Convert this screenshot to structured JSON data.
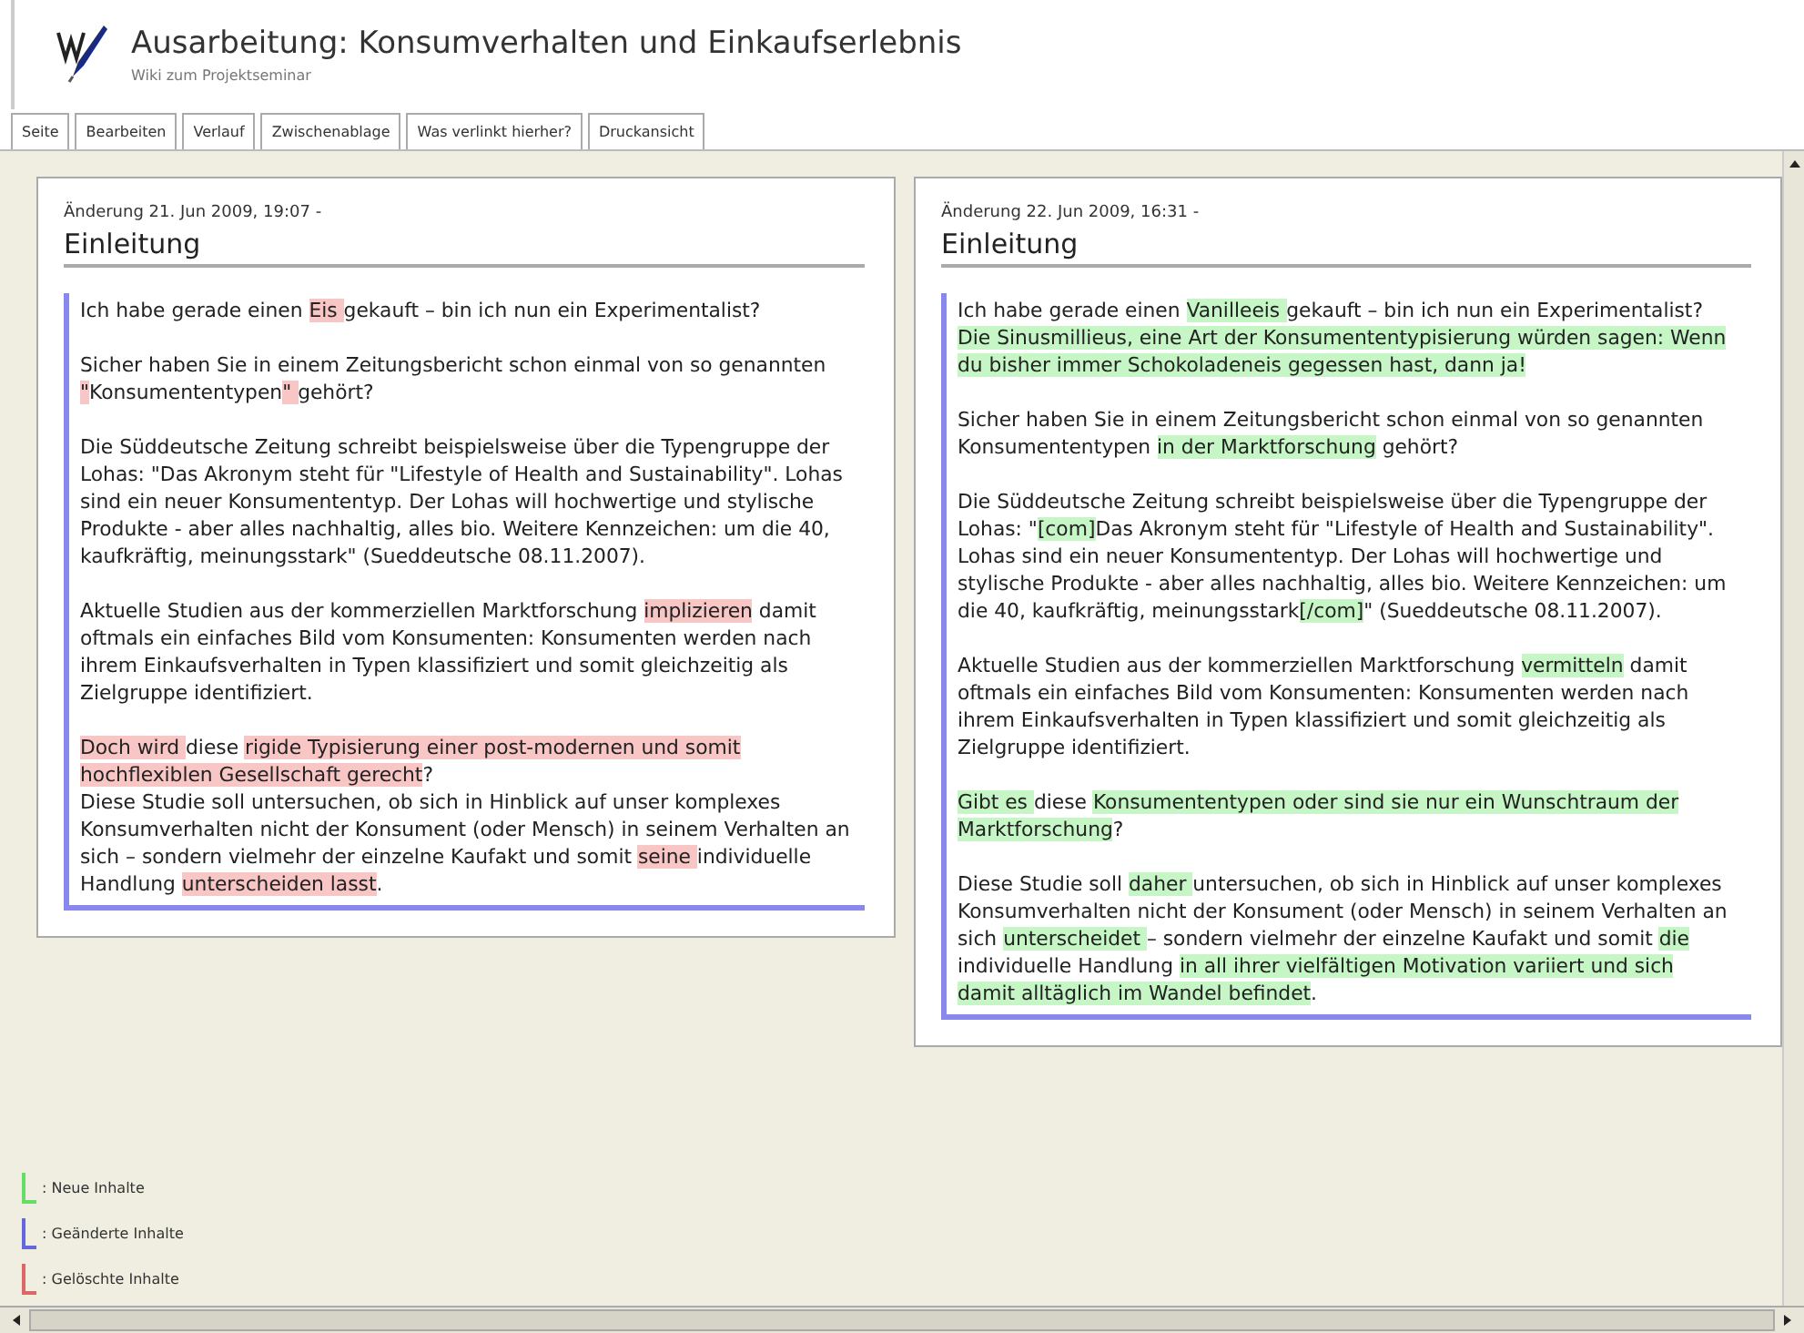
{
  "header": {
    "title": "Ausarbeitung: Konsumverhalten und Einkaufserlebnis",
    "subtitle": "Wiki zum Projektseminar"
  },
  "tabs": [
    {
      "label": "Seite"
    },
    {
      "label": "Bearbeiten"
    },
    {
      "label": "Verlauf"
    },
    {
      "label": "Zwischenablage"
    },
    {
      "label": "Was verlinkt hierher?"
    },
    {
      "label": "Druckansicht"
    }
  ],
  "revisions": [
    {
      "kind": "old",
      "meta": "Änderung 21. Jun 2009, 19:07 -",
      "heading": "Einleitung",
      "paragraphs": [
        [
          {
            "text": "Ich habe gerade einen ",
            "marked": false
          },
          {
            "text": "Eis ",
            "marked": true
          },
          {
            "text": "gekauft – bin ich nun ein Experimentalist?",
            "marked": false
          }
        ],
        [
          {
            "text": "Sicher haben Sie in einem Zeitungsbericht schon einmal von so genannten ",
            "marked": false
          },
          {
            "text": "\"",
            "marked": true
          },
          {
            "text": "Konsumententypen",
            "marked": false
          },
          {
            "text": "\" ",
            "marked": true
          },
          {
            "text": "gehört?",
            "marked": false
          }
        ],
        [
          {
            "text": "Die Süddeutsche Zeitung schreibt beispielsweise über die Typengruppe der Lohas: \"Das Akronym steht für \"Lifestyle of Health and Sustainability\". Lohas sind ein neuer Konsumententyp. Der Lohas will hochwertige und stylische Produkte - aber alles nachhaltig, alles bio. Weitere Kennzeichen: um die 40, kaufkräftig, meinungsstark\" (Sueddeutsche 08.11.2007).",
            "marked": false
          }
        ],
        [
          {
            "text": "Aktuelle Studien aus der kommerziellen Marktforschung ",
            "marked": false
          },
          {
            "text": "implizieren",
            "marked": true
          },
          {
            "text": " damit oftmals ein einfaches Bild vom Konsumenten: Konsumenten werden nach ihrem Einkaufsverhalten in Typen klassifiziert und somit gleichzeitig als Zielgruppe identifiziert.",
            "marked": false
          }
        ],
        [
          {
            "text": "Doch wird ",
            "marked": true
          },
          {
            "text": "diese ",
            "marked": false
          },
          {
            "text": "rigide Typisierung einer post-modernen und somit hochflexiblen Gesellschaft gerecht",
            "marked": true
          },
          {
            "text": "?\nDiese Studie soll untersuchen, ob sich in Hinblick auf unser komplexes Konsumverhalten nicht der Konsument (oder Mensch) in seinem Verhalten an sich – sondern vielmehr der einzelne Kaufakt und somit ",
            "marked": false
          },
          {
            "text": "seine ",
            "marked": true
          },
          {
            "text": "individuelle Handlung ",
            "marked": false
          },
          {
            "text": "unterscheiden lasst",
            "marked": true
          },
          {
            "text": ".",
            "marked": false
          }
        ]
      ]
    },
    {
      "kind": "new",
      "meta": "Änderung 22. Jun 2009, 16:31 -",
      "heading": "Einleitung",
      "paragraphs": [
        [
          {
            "text": "Ich habe gerade einen ",
            "marked": false
          },
          {
            "text": "Vanilleeis ",
            "marked": true
          },
          {
            "text": "gekauft – bin ich nun ein Experimentalist? ",
            "marked": false
          },
          {
            "text": "Die Sinusmillieus, eine Art der Konsumententypisierung würden sagen: Wenn du bisher immer Schokoladeneis gegessen hast, dann ja!",
            "marked": true
          }
        ],
        [
          {
            "text": "Sicher haben Sie in einem Zeitungsbericht schon einmal von so genannten Konsumententypen ",
            "marked": false
          },
          {
            "text": "in der Marktforschung",
            "marked": true
          },
          {
            "text": " gehört?",
            "marked": false
          }
        ],
        [
          {
            "text": "Die Süddeutsche Zeitung schreibt beispielsweise über die Typengruppe der Lohas: \"",
            "marked": false
          },
          {
            "text": "[com]",
            "marked": true
          },
          {
            "text": "Das Akronym steht für \"Lifestyle of Health and Sustainability\". Lohas sind ein neuer Konsumententyp. Der Lohas will hochwertige und stylische Produkte - aber alles nachhaltig, alles bio. Weitere Kennzeichen: um die 40, kaufkräftig, meinungsstark",
            "marked": false
          },
          {
            "text": "[/com]",
            "marked": true
          },
          {
            "text": "\" (Sueddeutsche 08.11.2007).",
            "marked": false
          }
        ],
        [
          {
            "text": "Aktuelle Studien aus der kommerziellen Marktforschung ",
            "marked": false
          },
          {
            "text": "vermitteln",
            "marked": true
          },
          {
            "text": " damit oftmals ein einfaches Bild vom Konsumenten: Konsumenten werden nach ihrem Einkaufsverhalten in Typen klassifiziert und somit gleichzeitig als Zielgruppe identifiziert.",
            "marked": false
          }
        ],
        [
          {
            "text": "Gibt es ",
            "marked": true
          },
          {
            "text": "diese ",
            "marked": false
          },
          {
            "text": "Konsumententypen oder sind sie nur ein Wunschtraum der Marktforschung",
            "marked": true
          },
          {
            "text": "?",
            "marked": false
          }
        ],
        [
          {
            "text": "Diese Studie soll ",
            "marked": false
          },
          {
            "text": "daher ",
            "marked": true
          },
          {
            "text": "untersuchen, ob sich in Hinblick auf unser komplexes Konsumverhalten nicht der Konsument (oder Mensch) in seinem Verhalten an sich ",
            "marked": false
          },
          {
            "text": "unterscheidet ",
            "marked": true
          },
          {
            "text": "– sondern vielmehr der einzelne Kaufakt und somit ",
            "marked": false
          },
          {
            "text": "die",
            "marked": true
          },
          {
            "text": " individuelle Handlung ",
            "marked": false
          },
          {
            "text": "in all ihrer vielfältigen Motivation variiert und sich damit alltäglich im Wandel befindet",
            "marked": true
          },
          {
            "text": ".",
            "marked": false
          }
        ]
      ]
    }
  ],
  "legend": [
    {
      "label": ": Neue Inhalte",
      "color": "#66dd66"
    },
    {
      "label": ": Geänderte Inhalte",
      "color": "#6666dd"
    },
    {
      "label": ": Gelöschte Inhalte",
      "color": "#dd6666"
    }
  ]
}
